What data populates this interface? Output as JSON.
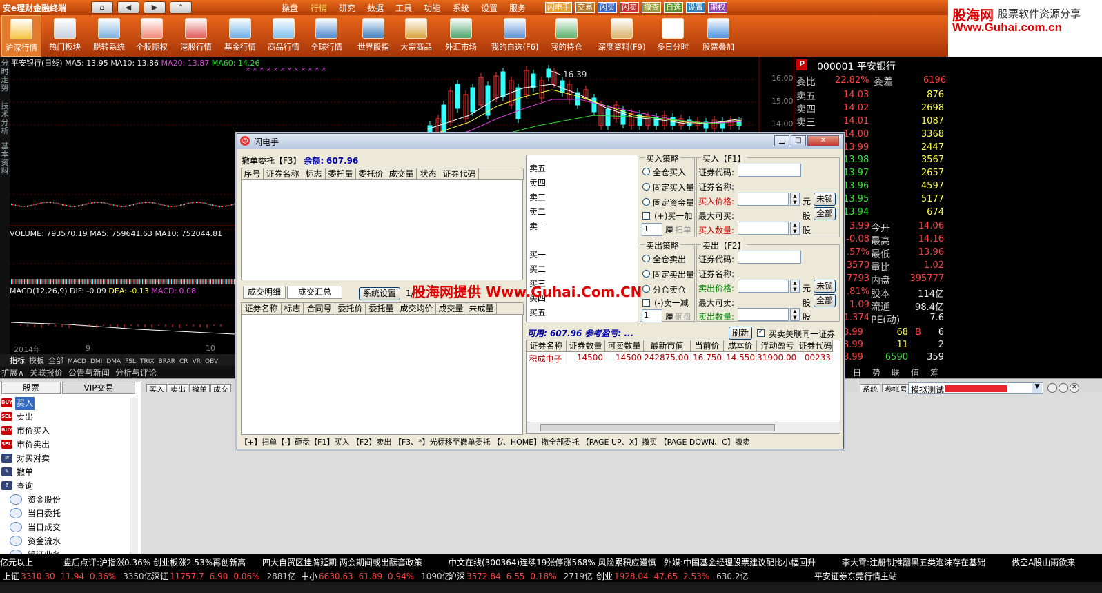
{
  "app": {
    "brand": "安e理财金融终端",
    "nav_buttons": [
      "⌂",
      "◀",
      "▶",
      "⌃"
    ],
    "menus": [
      "操盘",
      "行情",
      "研究",
      "数据",
      "工具",
      "功能",
      "系统",
      "设置",
      "服务"
    ],
    "active_menu": "行情",
    "quick_buttons": [
      "闪电手",
      "交易",
      "闪买",
      "闪卖",
      "撤查",
      "自选",
      "设置",
      "期权"
    ]
  },
  "logo": {
    "line1": "股海网",
    "line1b": "股票软件资源分享",
    "line2": "Www.Guhai.com.cn"
  },
  "toolbar": [
    "沪深行情",
    "热门板块",
    "脱转系统",
    "个股期权",
    "港股行情",
    "基金行情",
    "商品行情",
    "全球行情",
    "世界股指",
    "大宗商品",
    "外汇市场",
    "我的自选(F6)",
    "我的持仓",
    "深度资料(F9)",
    "多日分时",
    "股票叠加"
  ],
  "left_tabs": [
    "分时走势",
    "技术分析",
    "基本资料"
  ],
  "chart": {
    "title": "平安银行(日线)",
    "ma5": "MA5: 13.95",
    "ma10": "MA10: 13.86",
    "ma20": "MA20: 13.87",
    "ma60": "MA60: 14.26",
    "peak": "16.39",
    "price_axis": [
      "16.00",
      "15.00",
      "14.00"
    ],
    "volume": "VOLUME: 793570.19",
    "vol_ma5": "MA5: 759641.63",
    "vol_ma10": "MA10: 752044.81",
    "macd": "MACD(12,26,9)",
    "dif": "DIF: -0.09",
    "dea": "DEA: -0.13",
    "macd_val": "MACD: 0.08",
    "x_labels": [
      "2014年",
      "9",
      "10"
    ],
    "indicator_tabs": [
      "指标",
      "模板",
      "全部",
      "MACD",
      "DMI",
      "DMA",
      "FSL",
      "TRIX",
      "BRAR",
      "CR",
      "VR",
      "OBV"
    ],
    "bottom_tabs": [
      "扩展∧",
      "关联报价",
      "公告与新闻",
      "分析与评论"
    ]
  },
  "quote": {
    "code": "000001",
    "name": "平安银行",
    "weibi_label": "委比",
    "weibi": "22.82%",
    "weicha_label": "委差",
    "weicha": "6196",
    "sells": [
      {
        "l": "卖五",
        "p": "14.03",
        "v": "876"
      },
      {
        "l": "卖四",
        "p": "14.02",
        "v": "2698"
      },
      {
        "l": "卖三",
        "p": "14.01",
        "v": "1087"
      },
      {
        "l": "",
        "p": "14.00",
        "v": "3368"
      },
      {
        "l": "",
        "p": "13.99",
        "v": "2447"
      }
    ],
    "buys": [
      {
        "p": "13.98",
        "v": "3567"
      },
      {
        "p": "13.97",
        "v": "2657"
      },
      {
        "p": "13.96",
        "v": "4597"
      },
      {
        "p": "13.95",
        "v": "5177"
      },
      {
        "p": "13.94",
        "v": "674"
      }
    ],
    "stats": [
      {
        "a": "3.99",
        "b": "今开",
        "c": "14.06"
      },
      {
        "a": "-0.08",
        "b": "最高",
        "c": "14.16"
      },
      {
        "a": ".57%",
        "b": "最低",
        "c": "13.96"
      },
      {
        "a": "3570",
        "b": "量比",
        "c": "1.02"
      },
      {
        "a": "7793",
        "b": "内盘",
        "c": "395777"
      },
      {
        "a": ".81%",
        "b": "股本",
        "c": "114亿"
      },
      {
        "a": "1.09",
        "b": "流通",
        "c": "98.4亿"
      },
      {
        "a": "1.374",
        "b": "PE(动)",
        "c": "7.6"
      }
    ],
    "ticks": [
      {
        "p": "3.99",
        "v": "68",
        "f": "B",
        "n": "6"
      },
      {
        "p": "3.99",
        "v": "11",
        "f": "",
        "n": "2"
      },
      {
        "p": "3.99",
        "v": "6590",
        "f": "",
        "n": "359"
      }
    ],
    "tabs": [
      "日",
      "势",
      "联",
      "值",
      "筹"
    ]
  },
  "dialog": {
    "title": "闪电手",
    "cancel_title": "撤单委托【F3】",
    "balance_label": "余额:",
    "balance": "607.96",
    "cancel_cols": [
      "序号",
      "证券名称",
      "标志",
      "委托量",
      "委托价",
      "成交量",
      "状态",
      "证券代码"
    ],
    "tab1": "成交明细",
    "tab2": "成交汇总",
    "sys_btn": "系统设置",
    "page": "1/",
    "deal_cols": [
      "证券名称",
      "标志",
      "合同号",
      "委托价",
      "委托量",
      "成交均价",
      "成交量",
      "未成量"
    ],
    "book": [
      "卖五",
      "卖四",
      "卖三",
      "卖二",
      "卖一",
      "买一",
      "买二",
      "买三",
      "买四",
      "买五"
    ],
    "buy_strategy": "买入策略",
    "buy_opts": [
      "全仓买入",
      "固定买入量",
      "固定资金量"
    ],
    "buy_plus": "(+)买一加",
    "buy_unit": "厘",
    "buy_sweep": "扫单",
    "buy_default": "1",
    "sell_strategy": "卖出策略",
    "sell_opts": [
      "全仓卖出",
      "固定卖出量",
      "分仓卖仓"
    ],
    "sell_minus": "(-)卖一减",
    "sell_unit": "厘",
    "sell_hit": "砸盘",
    "sell_default": "1",
    "buy_title": "买入【F1】",
    "sell_title": "卖出【F2】",
    "code_label": "证券代码:",
    "name_label": "证券名称:",
    "buy_price": "买入价格:",
    "max_buy": "最大可买:",
    "buy_qty": "买入数量:",
    "sell_price": "卖出价格:",
    "max_sell": "最大可卖:",
    "sell_qty": "卖出数量:",
    "yuan": "元",
    "gu": "股",
    "unlock": "未锁",
    "all": "全部",
    "avail_label": "可用:",
    "avail": "607.96",
    "profit": "参考盈亏: ...",
    "refresh": "刷新",
    "linked": "买卖关联同一证券",
    "pos_cols": [
      "证券名称",
      "证券数量",
      "可卖数量",
      "最新市值",
      "当前价",
      "成本价",
      "浮动盈亏",
      "证券代码"
    ],
    "pos_row": [
      "积成电子",
      "14500",
      "14500",
      "242875.00",
      "16.750",
      "14.550",
      "31900.00",
      "00233"
    ],
    "help": "【+】扫单【-】砸盘【F1】买入 【F2】卖出 【F3、*】光标移至撤单委托 【/、HOME】撤全部委托 【PAGE UP、X】撤买 【PAGE DOWN、C】撤卖"
  },
  "watermark": "股海网提供 Www.Guhai.Com.CN",
  "trade": {
    "tabs": [
      "股票",
      "VIP交易"
    ],
    "buttons": [
      "买入",
      "卖出",
      "撤单",
      "成交"
    ],
    "right_buttons": [
      "系统",
      "参帐号"
    ],
    "account": "模拟测试",
    "menu": [
      {
        "t": "买入",
        "ic": "BUY"
      },
      {
        "t": "卖出",
        "ic": "SELL"
      },
      {
        "t": "市价买入",
        "ic": "BUY"
      },
      {
        "t": "市价卖出",
        "ic": "SELL"
      },
      {
        "t": "对买对卖",
        "ic": "⇄"
      },
      {
        "t": "撤单",
        "ic": "✎"
      },
      {
        "t": "查询",
        "ic": "?"
      }
    ],
    "sub": [
      "资金股份",
      "当日委托",
      "当日成交",
      "资金流水",
      "银证业务"
    ]
  },
  "news": [
    "亿元以上",
    "盘后点评:沪指涨0.36% 创业板涨2.53%再创新高",
    "四大自贸区挂牌延期 两会期间或出酝套政策",
    "中文在线(300364)连续19张停涨568% 风险累积应谨慎",
    "外媒:中国基金经理股票建议配比小幅回升",
    "李大霄:注册制推翻黑五类泡沫存在基础",
    "做空A股山雨欲来"
  ],
  "status": [
    {
      "n": "上证",
      "p": "3310.30",
      "c": "11.94",
      "r": "0.36%",
      "a": "3350亿"
    },
    {
      "n": "深证",
      "p": "11757.7",
      "c": "6.90",
      "r": "0.06%",
      "a": "2881亿"
    },
    {
      "n": "中小",
      "p": "6630.63",
      "c": "61.89",
      "r": "0.94%",
      "a": "1090亿"
    },
    {
      "n": "沪深",
      "p": "3572.84",
      "c": "6.55",
      "r": "0.18%",
      "a": "2719亿"
    },
    {
      "n": "创业",
      "p": "1928.04",
      "c": "47.65",
      "r": "2.53%",
      "a": "630.2亿"
    }
  ],
  "status_text": "平安证券东莞行情主站"
}
